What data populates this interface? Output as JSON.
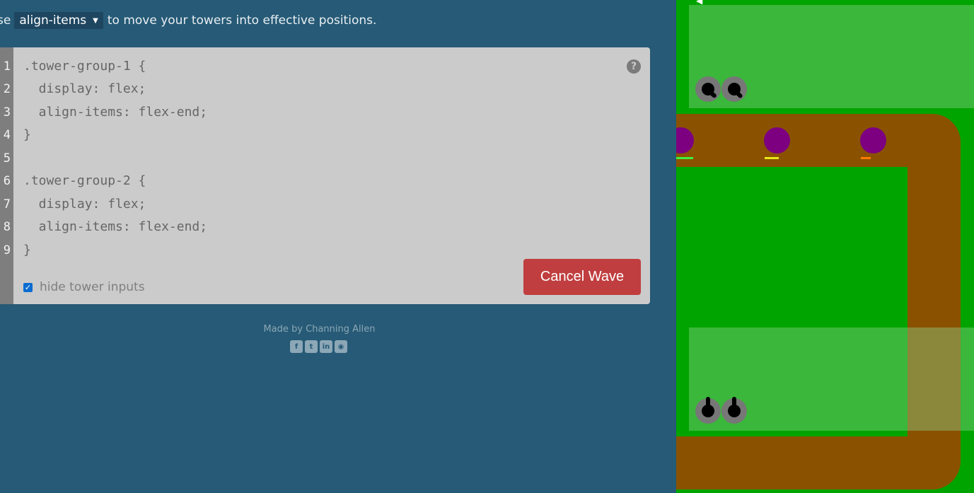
{
  "instruction": {
    "prefix": "se",
    "property": "align-items",
    "suffix": "to move your towers into effective positions."
  },
  "editor": {
    "line_numbers": [
      "1",
      "2",
      "3",
      "4",
      "5",
      "6",
      "7",
      "8",
      "9"
    ],
    "lines": [
      ".tower-group-1 {",
      "  display: flex;",
      "  align-items: flex-end;",
      "}",
      "",
      ".tower-group-2 {",
      "  display: flex;",
      "  align-items: flex-end;",
      "}"
    ],
    "help_label": "?",
    "hide_inputs_label": "hide tower inputs",
    "hide_inputs_checked": true,
    "cancel_label": "Cancel Wave"
  },
  "footer": {
    "credit": "Made by Channing Allen",
    "socials": [
      "facebook-icon",
      "twitter-icon",
      "linkedin-icon",
      "github-icon"
    ]
  },
  "colors": {
    "background": "#265a76",
    "editor_bg": "#cbcbcb",
    "cancel_button": "#c03e3f",
    "grass": "#00a400",
    "path": "#8a5200",
    "enemy": "#7c0080"
  }
}
